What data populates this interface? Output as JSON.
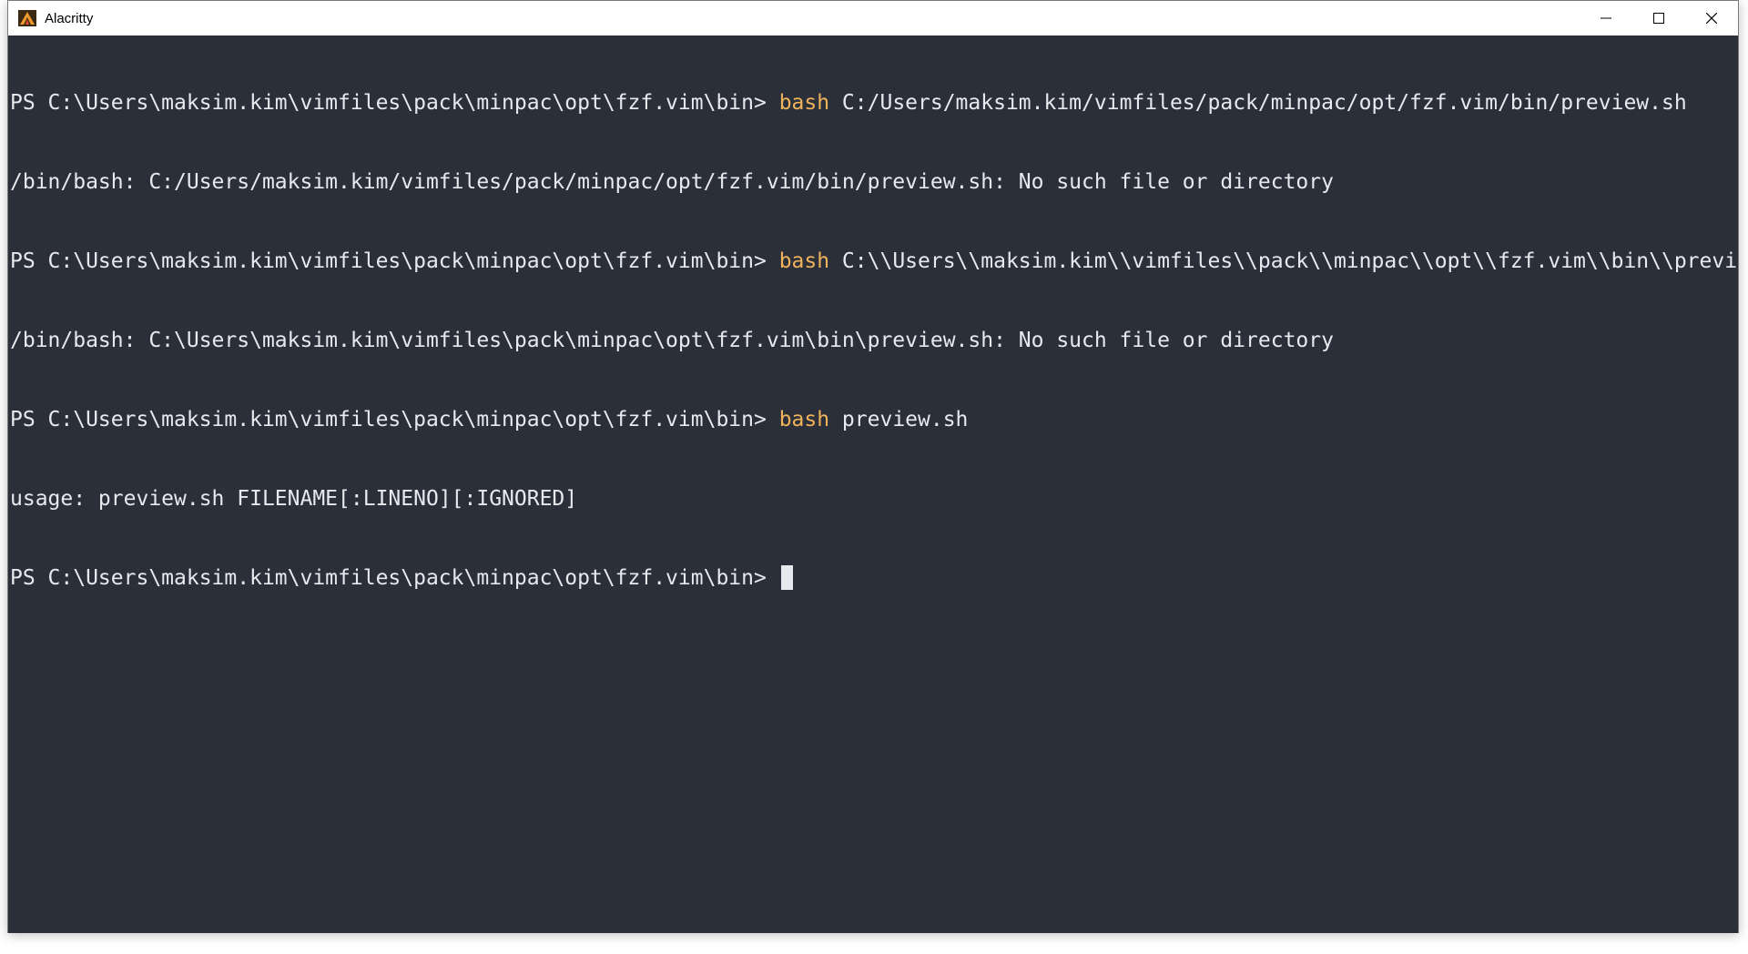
{
  "window": {
    "title": "Alacritty",
    "app_icon": "alacritty-icon",
    "controls": [
      "minimize-icon",
      "maximize-icon",
      "close-icon"
    ]
  },
  "colors": {
    "terminal_bg": "#2b2f3a",
    "text": "#e7e9ee",
    "keyword": "#f0b35a"
  },
  "terminal": {
    "lines": [
      {
        "prompt": "PS C:\\Users\\maksim.kim\\vimfiles\\pack\\minpac\\opt\\fzf.vim\\bin> ",
        "cmd": "bash",
        "args": " C:/Users/maksim.kim/vimfiles/pack/minpac/opt/fzf.vim/bin/preview.sh"
      },
      {
        "output": "/bin/bash: C:/Users/maksim.kim/vimfiles/pack/minpac/opt/fzf.vim/bin/preview.sh: No such file or directory"
      },
      {
        "prompt": "PS C:\\Users\\maksim.kim\\vimfiles\\pack\\minpac\\opt\\fzf.vim\\bin> ",
        "cmd": "bash",
        "args": " C:\\\\Users\\\\maksim.kim\\\\vimfiles\\\\pack\\\\minpac\\\\opt\\\\fzf.vim\\\\bin\\\\preview.sh"
      },
      {
        "output": "/bin/bash: C:\\Users\\maksim.kim\\vimfiles\\pack\\minpac\\opt\\fzf.vim\\bin\\preview.sh: No such file or directory"
      },
      {
        "prompt": "PS C:\\Users\\maksim.kim\\vimfiles\\pack\\minpac\\opt\\fzf.vim\\bin> ",
        "cmd": "bash",
        "args": " preview.sh"
      },
      {
        "output": "usage: preview.sh FILENAME[:LINENO][:IGNORED]"
      },
      {
        "prompt": "PS C:\\Users\\maksim.kim\\vimfiles\\pack\\minpac\\opt\\fzf.vim\\bin> ",
        "cmd": "",
        "args": ""
      }
    ]
  }
}
